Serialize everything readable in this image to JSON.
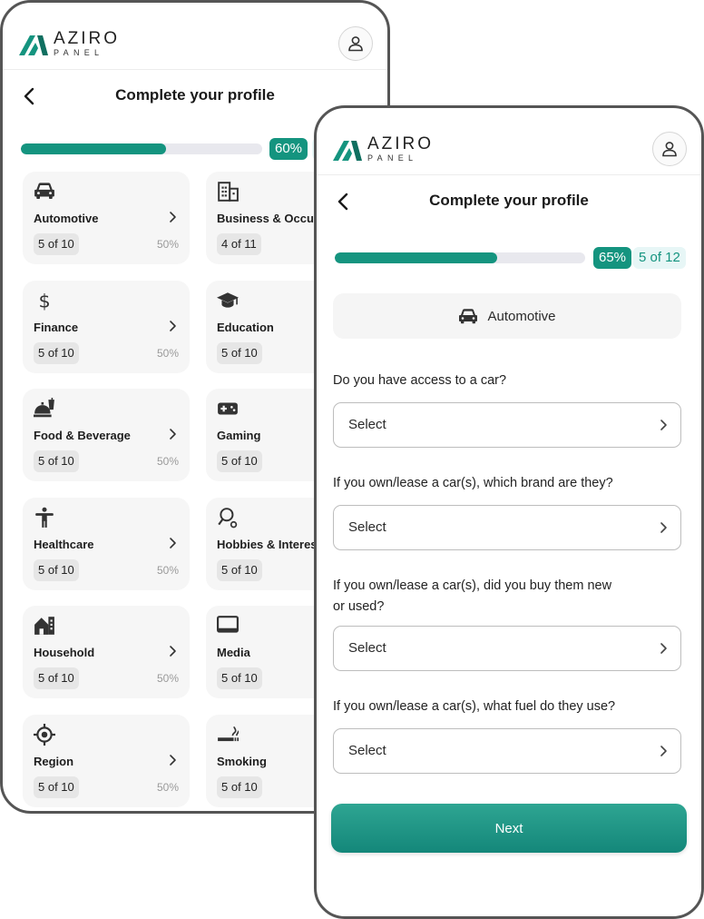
{
  "brand": {
    "name": "AZIRO",
    "subtitle": "PANEL",
    "accent": "#14947f"
  },
  "back_screen": {
    "title": "Complete your profile",
    "progress": {
      "percent_label": "60%",
      "fraction": 0.6
    },
    "categories": [
      {
        "name": "Automotive",
        "count": "5 of 10",
        "pct": "50%",
        "icon": "car-icon"
      },
      {
        "name": "Business & Occup",
        "count": "4 of 11",
        "pct": "",
        "icon": "building-icon"
      },
      {
        "name": "Finance",
        "count": "5 of 10",
        "pct": "50%",
        "icon": "dollar-icon"
      },
      {
        "name": "Education",
        "count": "5 of 10",
        "pct": "",
        "icon": "graduation-cap-icon"
      },
      {
        "name": "Food & Beverage",
        "count": "5 of 10",
        "pct": "50%",
        "icon": "food-icon"
      },
      {
        "name": "Gaming",
        "count": "5 of 10",
        "pct": "",
        "icon": "gamepad-icon"
      },
      {
        "name": "Healthcare",
        "count": "5 of 10",
        "pct": "50%",
        "icon": "person-icon"
      },
      {
        "name": "Hobbies & Interes",
        "count": "5 of 10",
        "pct": "",
        "icon": "hobby-icon"
      },
      {
        "name": "Household",
        "count": "5 of 10",
        "pct": "50%",
        "icon": "house-icon"
      },
      {
        "name": "Media",
        "count": "5 of 10",
        "pct": "",
        "icon": "monitor-icon"
      },
      {
        "name": "Region",
        "count": "5 of 10",
        "pct": "50%",
        "icon": "target-icon"
      },
      {
        "name": "Smoking",
        "count": "5 of 10",
        "pct": "",
        "icon": "smoking-icon"
      }
    ]
  },
  "front_screen": {
    "title": "Complete your profile",
    "progress": {
      "percent_label": "65%",
      "count_label": "5 of 12",
      "fraction": 0.65
    },
    "category": "Automotive",
    "questions": [
      {
        "label": "Do you have access to a car?",
        "placeholder": "Select"
      },
      {
        "label": "If you own/lease a car(s), which brand are they?",
        "placeholder": "Select"
      },
      {
        "label": "If you own/lease a car(s), did you buy them new or used?",
        "placeholder": "Select"
      },
      {
        "label": "If you own/lease a car(s), what fuel do they use?",
        "placeholder": "Select"
      }
    ],
    "next_label": "Next"
  }
}
